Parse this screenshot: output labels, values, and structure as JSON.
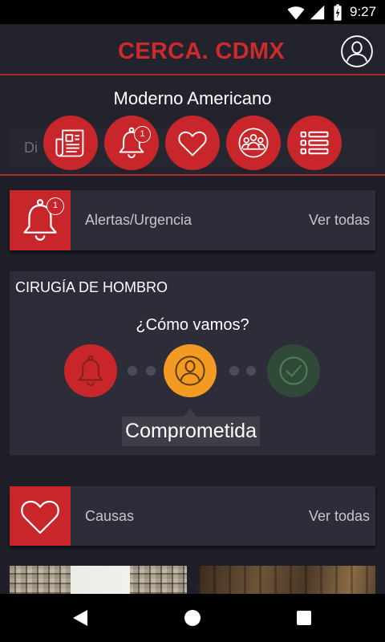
{
  "status_bar": {
    "time": "9:27",
    "icons": [
      "wifi-icon",
      "signal-icon",
      "battery-charging-icon"
    ]
  },
  "header": {
    "title": "CERCA. CDMX",
    "profile_icon": "user-circle-icon"
  },
  "location": {
    "name": "Moderno Americano",
    "search_hint": "Di"
  },
  "quick_actions": [
    {
      "icon": "newspaper-icon"
    },
    {
      "icon": "bell-icon",
      "badge": "1"
    },
    {
      "icon": "heart-icon"
    },
    {
      "icon": "community-icon"
    },
    {
      "icon": "list-icon"
    }
  ],
  "alerts": {
    "icon": "bell-icon",
    "badge": "1",
    "label": "Alertas/Urgencia",
    "link": "Ver todas"
  },
  "tracker": {
    "title": "CIRUGÍA DE HOMBRO",
    "question": "¿Cómo vamos?",
    "steps": [
      {
        "icon": "bell-icon",
        "color": "#c8262b"
      },
      {
        "icon": "person-circle-icon",
        "color": "#f39a22"
      },
      {
        "icon": "check-circle-icon",
        "color": "#2f4a37"
      }
    ],
    "current_label": "Comprometida"
  },
  "causes": {
    "icon": "heart-icon",
    "label": "Causas",
    "link": "Ver todas"
  },
  "nav_bar": {
    "icons": [
      "back-icon",
      "home-icon",
      "recents-icon"
    ]
  },
  "colors": {
    "accent": "#c8262b",
    "background": "#1e1f28",
    "card": "#2c2d39",
    "step_dot": "#4b4c57"
  }
}
